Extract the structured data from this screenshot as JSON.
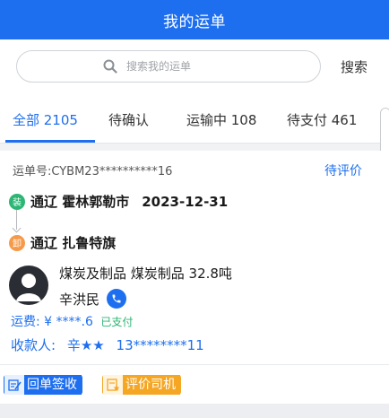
{
  "header": {
    "title": "我的运单"
  },
  "search": {
    "placeholder": "搜索我的运单",
    "button_label": "搜索"
  },
  "tabs": [
    {
      "label": "全部 2105",
      "active": true
    },
    {
      "label": "待确认",
      "active": false
    },
    {
      "label": "运输中 108",
      "active": false
    },
    {
      "label": "待支付 461",
      "active": false
    }
  ],
  "order": {
    "waybill_no": "运单号:CYBM23**********16",
    "status": "待评价",
    "load": {
      "badge": "装",
      "place": "通辽 霍林郭勒市",
      "date": "2023-12-31"
    },
    "unload": {
      "badge": "卸",
      "place": "通辽 扎鲁特旗"
    },
    "cargo": "煤炭及制品  煤炭制品 32.8吨",
    "driver": "辛洪民",
    "fee_label": "运费:",
    "fee_value": "¥ ****.6",
    "fee_status": "已支付",
    "payee_label": "收款人:",
    "payee_name": "辛★★",
    "payee_phone": "13********11",
    "actions": {
      "receipt": "回单签收",
      "rate": "评价司机"
    }
  },
  "colors": {
    "primary": "#1d6ff0",
    "success": "#2bb673",
    "warning": "#f5a623",
    "unload": "#f59a4a"
  },
  "icons": [
    "search-icon",
    "avatar-icon",
    "phone-icon",
    "receipt-sign-icon",
    "rate-driver-icon",
    "arrow-down-icon"
  ]
}
